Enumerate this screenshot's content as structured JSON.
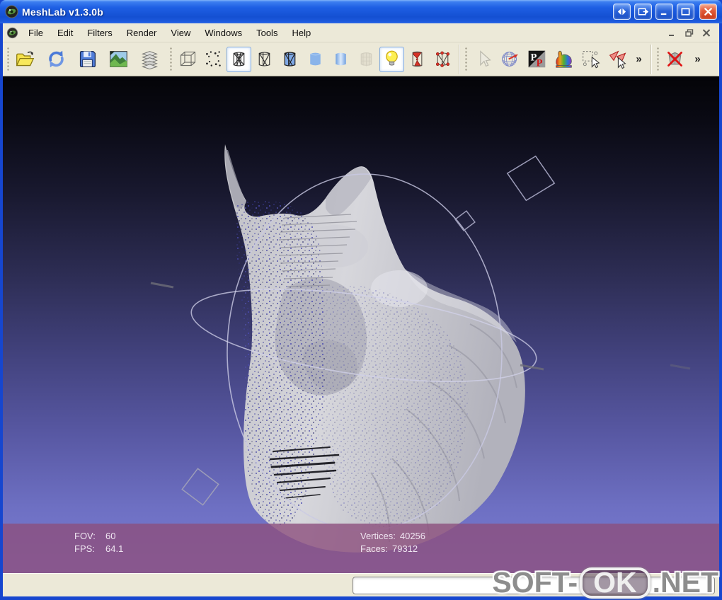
{
  "titlebar": {
    "title": "MeshLab v1.3.0b",
    "app_icon": "meshlab-eye-icon",
    "buttons": [
      "window-arrows",
      "window-detach",
      "minimize",
      "maximize",
      "close"
    ]
  },
  "menubar": {
    "app_icon": "meshlab-eye-icon",
    "items": [
      "File",
      "Edit",
      "Filters",
      "Render",
      "View",
      "Windows",
      "Tools",
      "Help"
    ],
    "window_controls": [
      "minimize",
      "restore",
      "close"
    ]
  },
  "toolbar": {
    "overflow_glyph": "»",
    "buttons": [
      "open-project",
      "reload",
      "save",
      "snapshot",
      "layers",
      "bounding-box",
      "points",
      "wireframe",
      "hidden-lines",
      "flat-lines",
      "flat",
      "smooth",
      "texture",
      "light",
      "fancy-lighting",
      "selected-vertices-display",
      "edit-pointer",
      "trackball-decoration",
      "pp-plugin",
      "colorize",
      "select-vertices",
      "select-faces",
      "delete-mesh"
    ],
    "active_buttons": [
      "wireframe",
      "light"
    ],
    "disabled_buttons": [
      "texture",
      "edit-pointer"
    ]
  },
  "viewport": {
    "hud": {
      "fov_label": "FOV:",
      "fov_value": "60",
      "fps_label": "FPS:",
      "fps_value": "64.1",
      "vertices_label": "Vertices:",
      "vertices_value": "40256",
      "faces_label": "Faces:",
      "faces_value": "79312"
    }
  },
  "statusbar": {
    "progress_percent": 0
  },
  "watermark": {
    "prefix": "SOFT-",
    "boxed": "OK",
    "suffix": ".NET"
  },
  "colors": {
    "titlebar_blue": "#1e5fe4",
    "close_red": "#e25b3a",
    "chrome_tan": "#ece9d8",
    "hud_maroon": "#8c4f7d",
    "viewport_top": "#040408",
    "viewport_bottom": "#7a7cd3",
    "selection_border": "#84abdd"
  }
}
